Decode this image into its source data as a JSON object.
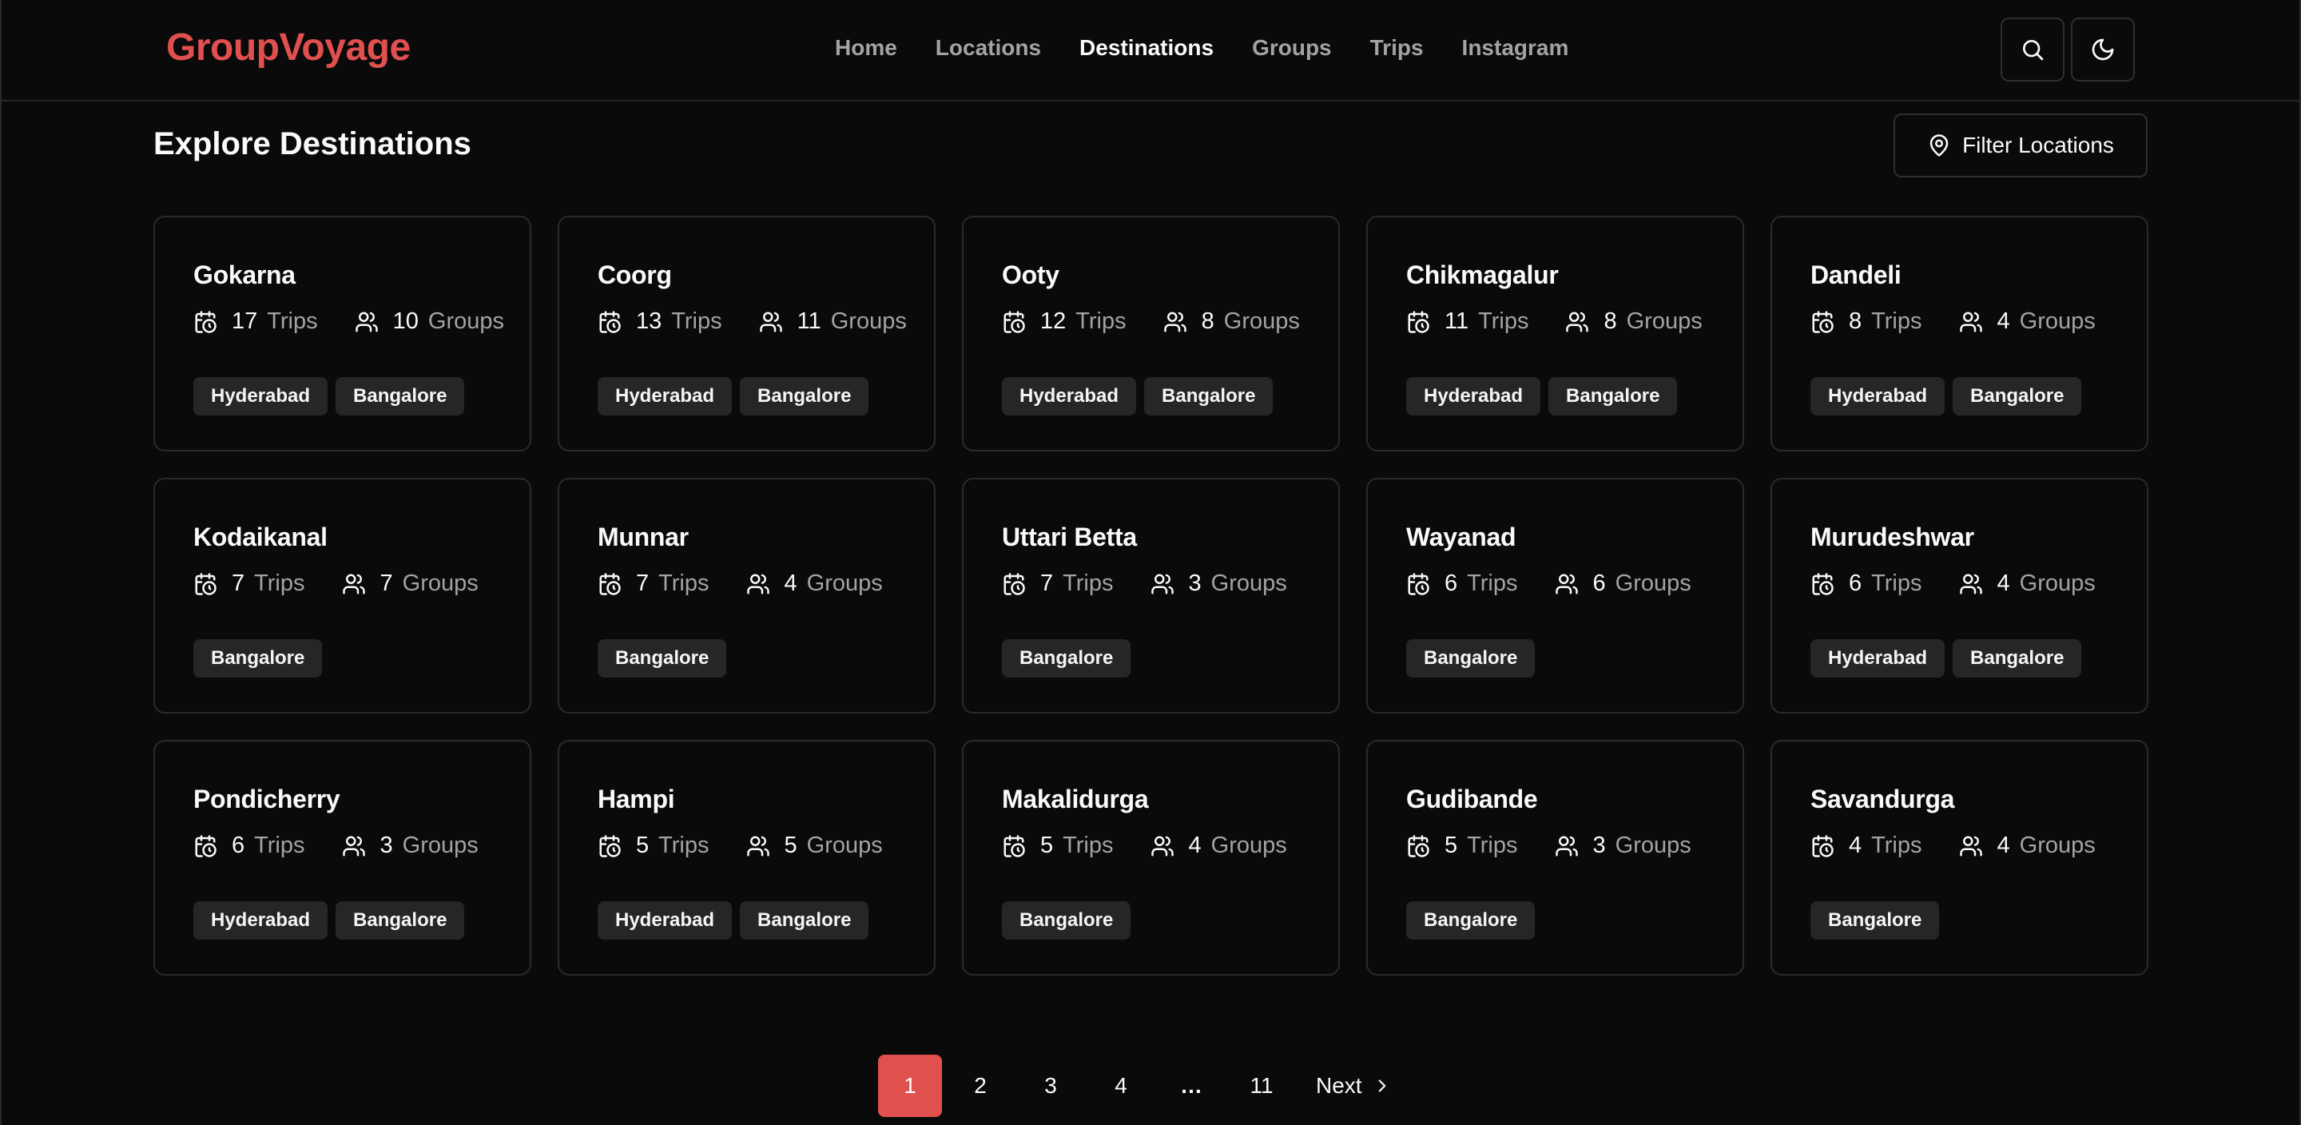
{
  "header": {
    "logo": "GroupVoyage",
    "nav": [
      {
        "label": "Home",
        "active": false
      },
      {
        "label": "Locations",
        "active": false
      },
      {
        "label": "Destinations",
        "active": true
      },
      {
        "label": "Groups",
        "active": false
      },
      {
        "label": "Trips",
        "active": false
      },
      {
        "label": "Instagram",
        "active": false
      }
    ],
    "actions": {
      "search_icon": "search-icon",
      "theme_icon": "moon-icon"
    }
  },
  "main": {
    "title": "Explore Destinations",
    "filter_label": "Filter Locations",
    "trips_label": "Trips",
    "groups_label": "Groups",
    "destinations": [
      {
        "name": "Gokarna",
        "trips": 17,
        "groups": 10,
        "locations": [
          "Hyderabad",
          "Bangalore"
        ]
      },
      {
        "name": "Coorg",
        "trips": 13,
        "groups": 11,
        "locations": [
          "Hyderabad",
          "Bangalore"
        ]
      },
      {
        "name": "Ooty",
        "trips": 12,
        "groups": 8,
        "locations": [
          "Hyderabad",
          "Bangalore"
        ]
      },
      {
        "name": "Chikmagalur",
        "trips": 11,
        "groups": 8,
        "locations": [
          "Hyderabad",
          "Bangalore"
        ]
      },
      {
        "name": "Dandeli",
        "trips": 8,
        "groups": 4,
        "locations": [
          "Hyderabad",
          "Bangalore"
        ]
      },
      {
        "name": "Kodaikanal",
        "trips": 7,
        "groups": 7,
        "locations": [
          "Bangalore"
        ]
      },
      {
        "name": "Munnar",
        "trips": 7,
        "groups": 4,
        "locations": [
          "Bangalore"
        ]
      },
      {
        "name": "Uttari Betta",
        "trips": 7,
        "groups": 3,
        "locations": [
          "Bangalore"
        ]
      },
      {
        "name": "Wayanad",
        "trips": 6,
        "groups": 6,
        "locations": [
          "Bangalore"
        ]
      },
      {
        "name": "Murudeshwar",
        "trips": 6,
        "groups": 4,
        "locations": [
          "Hyderabad",
          "Bangalore"
        ]
      },
      {
        "name": "Pondicherry",
        "trips": 6,
        "groups": 3,
        "locations": [
          "Hyderabad",
          "Bangalore"
        ]
      },
      {
        "name": "Hampi",
        "trips": 5,
        "groups": 5,
        "locations": [
          "Hyderabad",
          "Bangalore"
        ]
      },
      {
        "name": "Makalidurga",
        "trips": 5,
        "groups": 4,
        "locations": [
          "Bangalore"
        ]
      },
      {
        "name": "Gudibande",
        "trips": 5,
        "groups": 3,
        "locations": [
          "Bangalore"
        ]
      },
      {
        "name": "Savandurga",
        "trips": 4,
        "groups": 4,
        "locations": [
          "Bangalore"
        ]
      }
    ]
  },
  "pagination": {
    "pages": [
      "1",
      "2",
      "3",
      "4",
      "…",
      "11"
    ],
    "current": "1",
    "next_label": "Next"
  },
  "colors": {
    "accent": "#e0504f",
    "background": "#0a0a0a",
    "border": "#2a2a2a",
    "tag_bg": "#262626",
    "muted_text": "#a3a3a3"
  }
}
